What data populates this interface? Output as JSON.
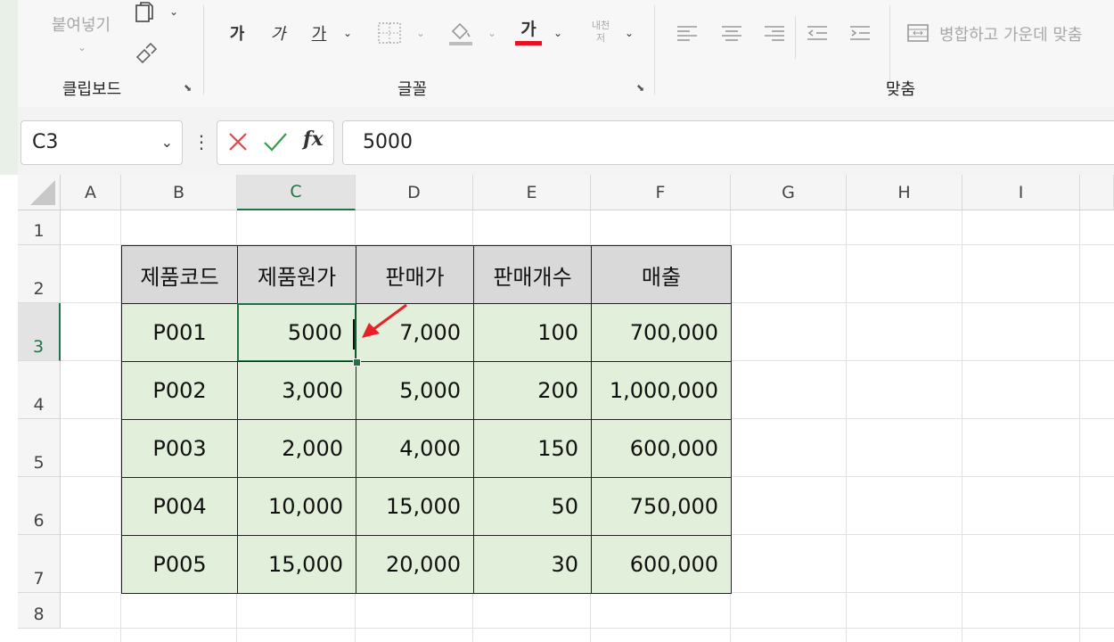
{
  "ribbon": {
    "paste_label": "붙여넣기",
    "groups": {
      "clipboard": "클립보드",
      "font": "글꼴",
      "alignment": "맞춤"
    },
    "font_buttons": {
      "bold": "가",
      "italic": "가",
      "underline": "가",
      "font_color": "가"
    },
    "wrap_text_label": "내천\n저",
    "merge_label": "병합하고 가운데 맞춤"
  },
  "namebox": {
    "value": "C3"
  },
  "formula_bar": {
    "value": "5000"
  },
  "columns": [
    "A",
    "B",
    "C",
    "D",
    "E",
    "F",
    "G",
    "H",
    "I"
  ],
  "rows": [
    "1",
    "2",
    "3",
    "4",
    "5",
    "6",
    "7",
    "8"
  ],
  "selected_cell": "C3",
  "table": {
    "headers": [
      "제품코드",
      "제품원가",
      "판매가",
      "판매개수",
      "매출"
    ],
    "rows": [
      [
        "P001",
        "5000",
        "7,000",
        "100",
        "700,000"
      ],
      [
        "P002",
        "3,000",
        "5,000",
        "200",
        "1,000,000"
      ],
      [
        "P003",
        "2,000",
        "4,000",
        "150",
        "600,000"
      ],
      [
        "P004",
        "10,000",
        "15,000",
        "50",
        "750,000"
      ],
      [
        "P005",
        "15,000",
        "20,000",
        "30",
        "600,000"
      ]
    ]
  },
  "colors": {
    "accent": "#217346",
    "header_fill": "#d9d9d9",
    "data_fill": "#e2efda",
    "arrow": "#e8202a",
    "font_color_bar": "#e81123"
  }
}
